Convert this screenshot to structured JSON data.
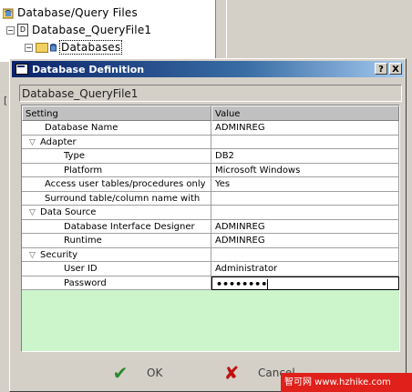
{
  "tree": {
    "root_label": "Database/Query Files",
    "file_label": "Database_QueryFile1",
    "file_icon_letter": "D",
    "folder_label": "Databases"
  },
  "dialog": {
    "title": "Database Definition",
    "help_button": "?",
    "close_button": "X",
    "file_name": "Database_QueryFile1",
    "columns": {
      "setting": "Setting",
      "value": "Value"
    },
    "rows": [
      {
        "setting": "Database Name",
        "value": "ADMINREG"
      },
      {
        "setting": "Adapter",
        "value": ""
      },
      {
        "setting": "Type",
        "value": "DB2"
      },
      {
        "setting": "Platform",
        "value": "Microsoft Windows"
      },
      {
        "setting": "Access user tables/procedures only",
        "value": "Yes"
      },
      {
        "setting": "Surround table/column name with",
        "value": ""
      },
      {
        "setting": "Data Source",
        "value": ""
      },
      {
        "setting": "Database Interface Designer",
        "value": "ADMINREG"
      },
      {
        "setting": "Runtime",
        "value": "ADMINREG"
      },
      {
        "setting": "Security",
        "value": ""
      },
      {
        "setting": "User ID",
        "value": "Administrator"
      },
      {
        "setting": "Password",
        "value": "••••••••"
      }
    ],
    "ok_label": "OK",
    "cancel_label": "Cancel"
  },
  "left_stub_label": "[",
  "watermark": "智可网 www.hzhike.com",
  "colors": {
    "title_start": "#0a246a",
    "title_end": "#a6caf0",
    "grid_empty": "#ccf5cc",
    "ok_check": "#2a8a2a",
    "cancel_x": "#c01010"
  }
}
